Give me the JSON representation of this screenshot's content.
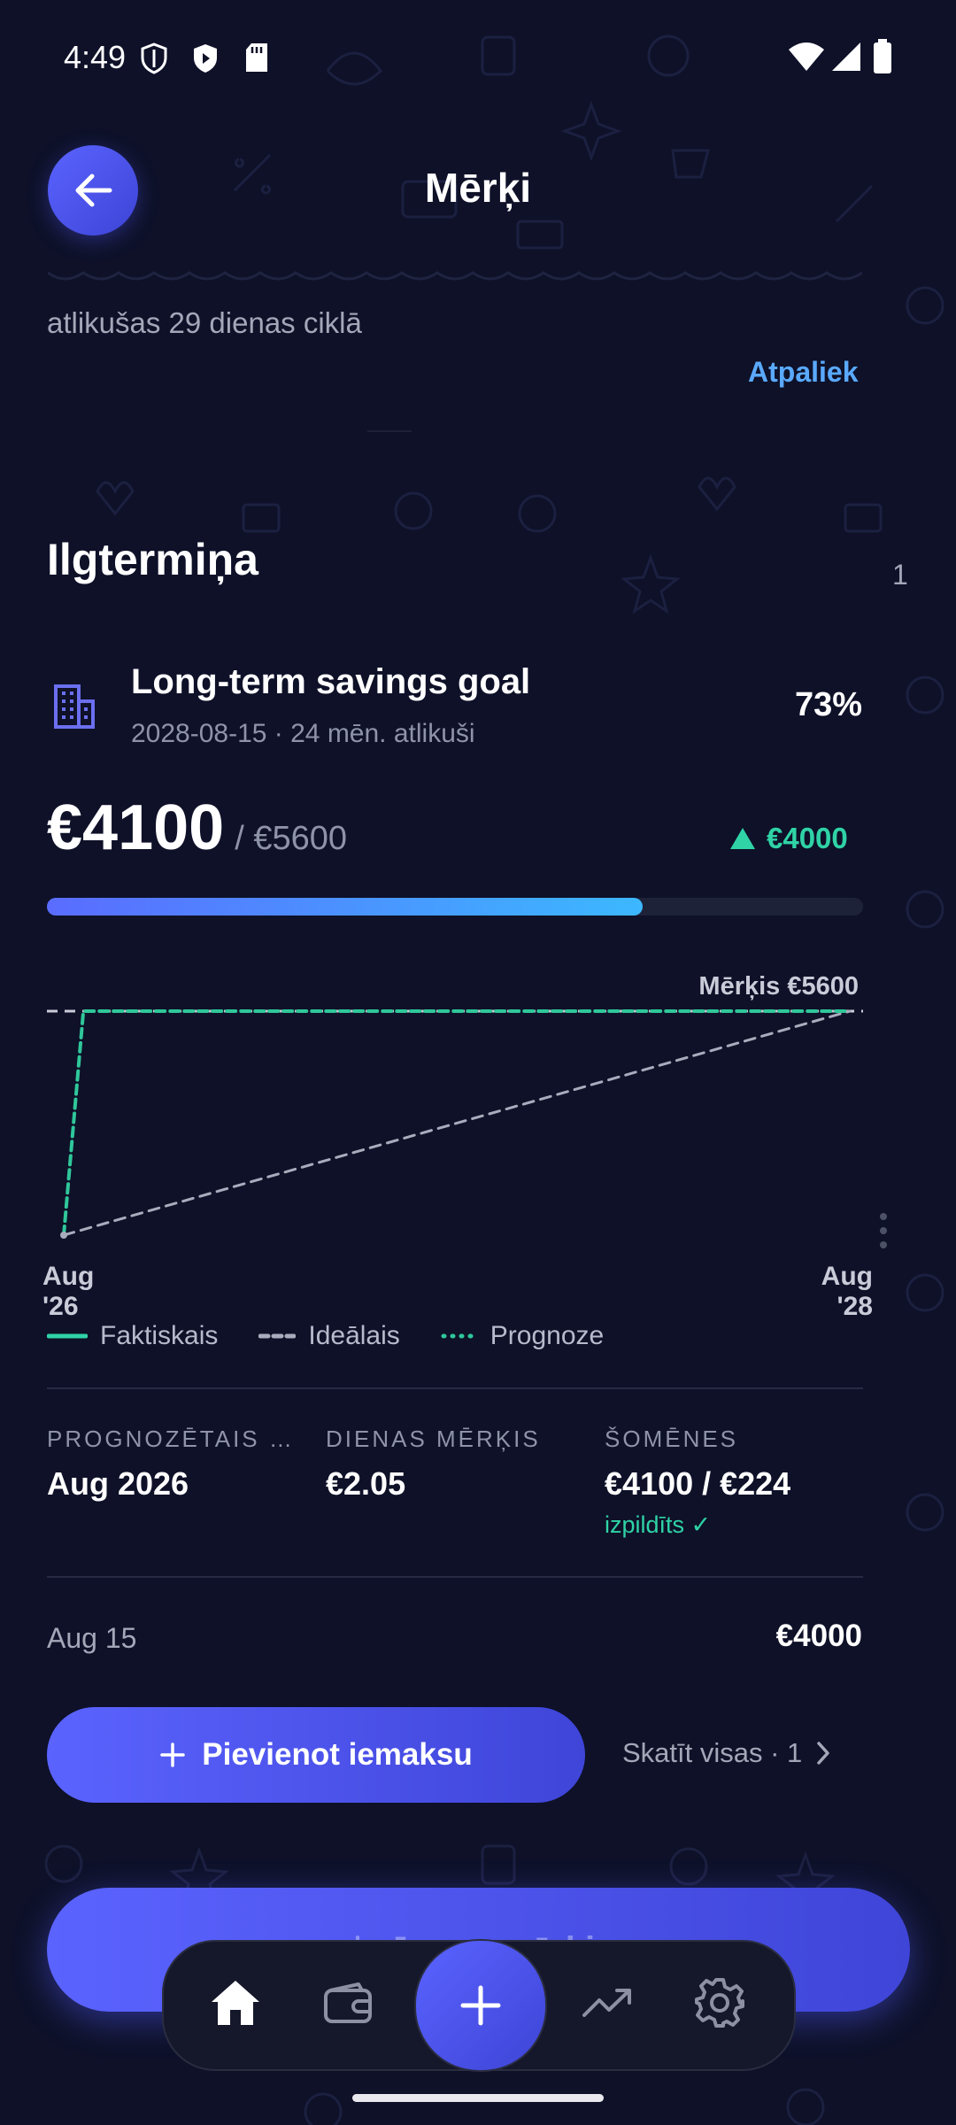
{
  "status_bar": {
    "time": "4:49"
  },
  "header": {
    "title": "Mērķi"
  },
  "prev_goal": {
    "remaining_text": "atlikušas 29 dienas ciklā",
    "status_label": "Atpaliek"
  },
  "section": {
    "title": "Ilgtermiņa",
    "count": "1"
  },
  "goal": {
    "name": "Long-term savings goal",
    "subtitle": "2028-08-15 · 24 mēn. atlikuši",
    "percent": "73%",
    "amount": "€4100",
    "target": "/ €5600",
    "delta": "€4000",
    "progress": 0.73
  },
  "chart_data": {
    "type": "line",
    "target_label": "Mērķis €5600",
    "target_value": 5600,
    "ylim": [
      0,
      5600
    ],
    "x_ticks": [
      {
        "line1": "Aug",
        "line2": "'26"
      },
      {
        "line1": "Aug",
        "line2": "'28"
      }
    ],
    "series": [
      {
        "name": "Faktiskais",
        "values": []
      },
      {
        "name": "Ideālais",
        "points": [
          [
            0,
            0
          ],
          [
            24,
            5600
          ]
        ]
      },
      {
        "name": "Prognoze",
        "points": [
          [
            0,
            0
          ],
          [
            0.6,
            5600
          ],
          [
            24,
            5600
          ]
        ]
      }
    ],
    "legend": [
      "Faktiskais",
      "Ideālais",
      "Prognoze"
    ],
    "colors": {
      "actual": "#2fd3a6",
      "ideal": "#a9acbc",
      "forecast": "#2fc79a",
      "target": "#c9ccd8"
    }
  },
  "stats": [
    {
      "label": "PROGNOZĒTAIS BEIGU DATUMS",
      "value": "Aug 2026"
    },
    {
      "label": "DIENAS MĒRĶIS",
      "value": "€2.05"
    },
    {
      "label": "ŠOMĒNES",
      "value": "€4100 / €224",
      "badge": "izpildīts ✓"
    }
  ],
  "contribution": {
    "date": "Aug 15",
    "amount": "€4000"
  },
  "actions": {
    "add_contribution": "Pievienot iemaksu",
    "view_all": "Skatīt visas · 1",
    "new_goal": "Jauns mērķis"
  },
  "colors": {
    "accent": "#5a63ff",
    "positive": "#2fd3a6",
    "link": "#5aa9ff",
    "background": "#0e1128"
  }
}
